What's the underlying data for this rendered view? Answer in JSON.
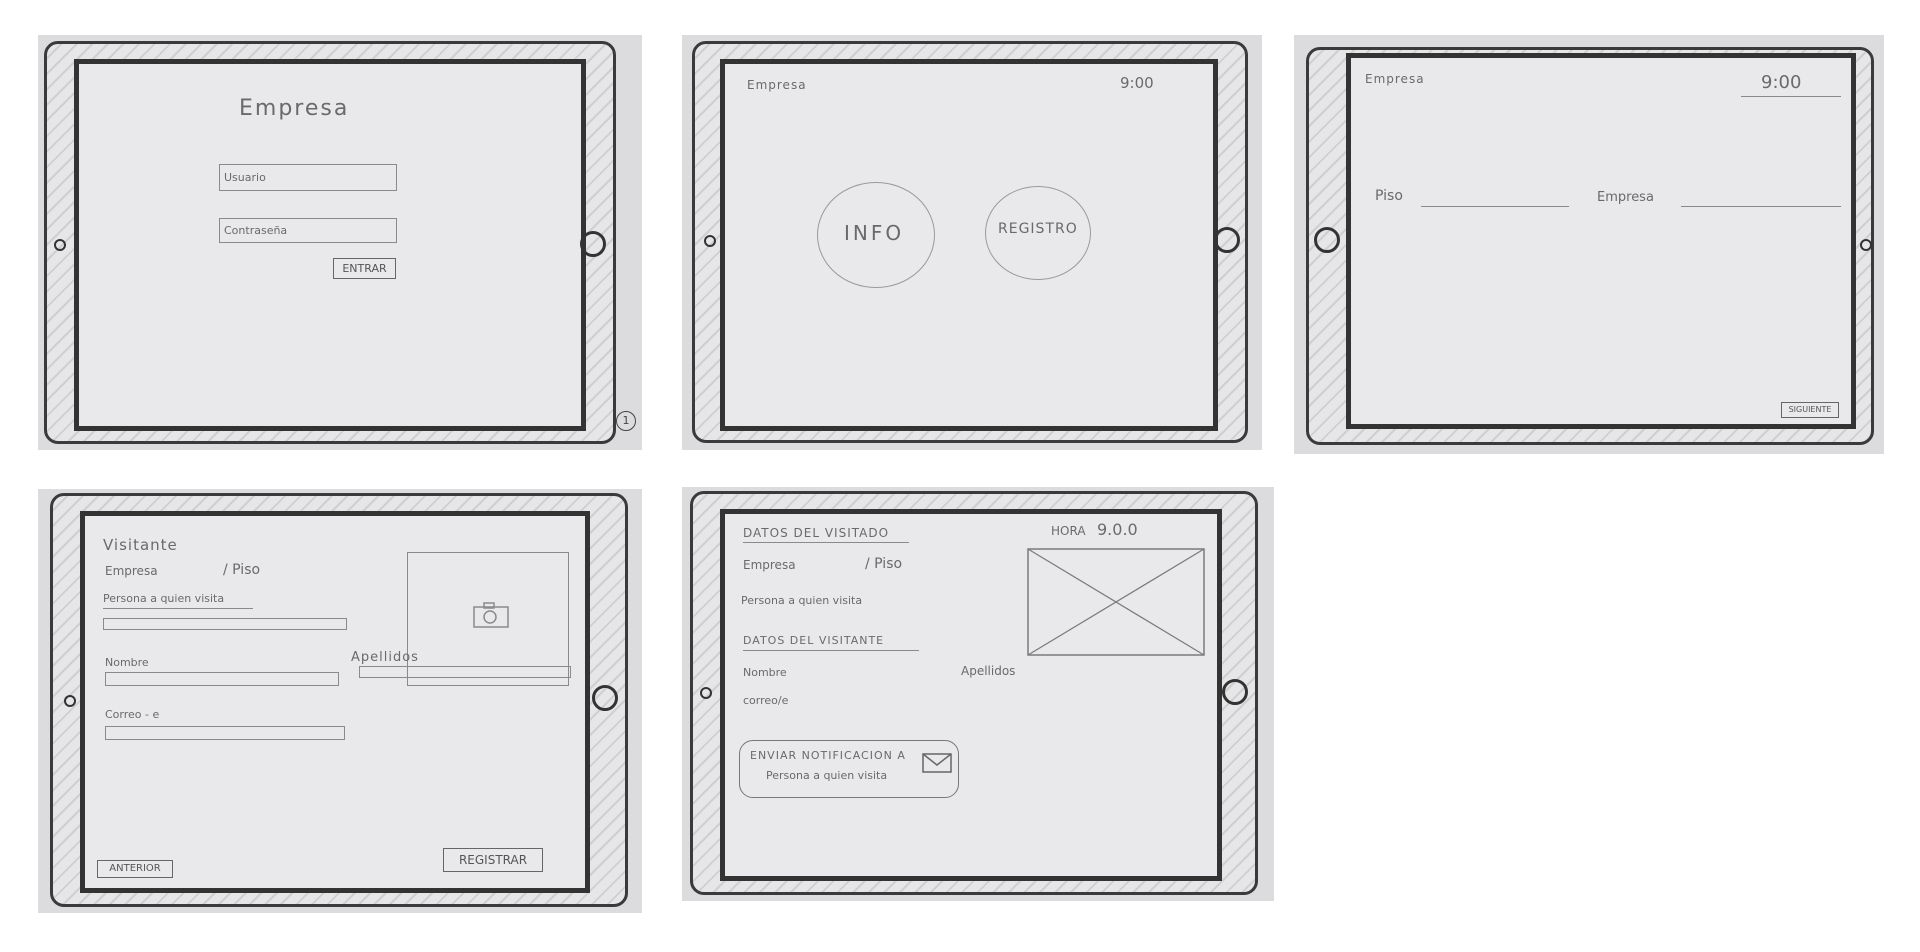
{
  "sketch1": {
    "title": "Empresa",
    "user_placeholder": "Usuario",
    "password_placeholder": "Contraseña",
    "enter_label": "ENTRAR",
    "page_number": "1"
  },
  "sketch2": {
    "company": "Empresa",
    "time": "9:00",
    "info_label": "INFO",
    "register_label": "REGISTRO"
  },
  "sketch3": {
    "company": "Empresa",
    "time": "9:00",
    "floor_label": "Piso",
    "company_label": "Empresa",
    "next_label": "SIGUIENTE"
  },
  "sketch4": {
    "title": "Visitante",
    "company_floor_company": "Empresa",
    "company_floor_floor": "/ Piso",
    "person_label": "Persona a quien visita",
    "name_label": "Nombre",
    "lastname_label": "Apellidos",
    "email_label": "Correo - e",
    "prev_label": "ANTERIOR",
    "register_label": "REGISTRAR"
  },
  "sketch5": {
    "visited_heading": "Datos del visitado",
    "hour_label": "Hora",
    "time": "9.0.0",
    "company": "Empresa",
    "floor": "/ Piso",
    "person_visited": "Persona a quien visita",
    "visitor_heading": "Datos del visitante",
    "name_label": "Nombre",
    "lastname_label": "Apellidos",
    "email_label": "correo/e",
    "notify_line1": "Enviar notificacion a",
    "notify_line2": "Persona a quien visita"
  }
}
